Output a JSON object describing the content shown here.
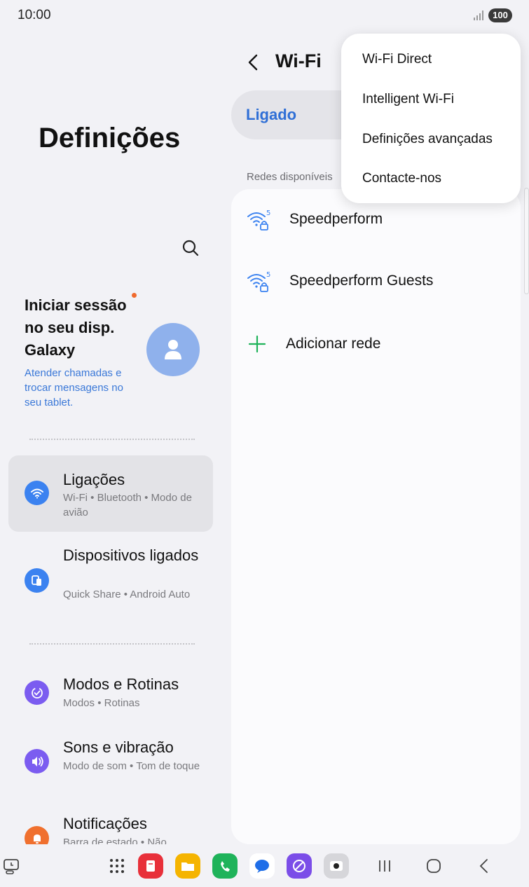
{
  "status_bar": {
    "time": "10:00",
    "battery": "100",
    "signal_icon": "signal-icon"
  },
  "settings": {
    "title": "Definições",
    "account": {
      "title": "Iniciar sessão no seu disp. Galaxy",
      "subtitle": "Atender chamadas e trocar mensagens no seu tablet."
    },
    "items": [
      {
        "title": "Ligações",
        "subtitle": "Wi-Fi  •  Bluetooth  •  Modo de avião",
        "icon": "wifi-icon",
        "color": "#3b82f0"
      },
      {
        "title": "Dispositivos ligados",
        "subtitle": "Quick Share  •  Android Auto",
        "icon": "devices-icon",
        "color": "#3b82f0"
      },
      {
        "title": "Modos e Rotinas",
        "subtitle": "Modos  •  Rotinas",
        "icon": "check-circle-icon",
        "color": "#7b5cf0"
      },
      {
        "title": "Sons e vibração",
        "subtitle": "Modo de som  •  Tom de toque",
        "icon": "sound-icon",
        "color": "#7b5cf0"
      },
      {
        "title": "Notificações",
        "subtitle": "Barra de estado  •  Não",
        "icon": "bell-icon",
        "color": "#f0702e"
      }
    ]
  },
  "wifi": {
    "title": "Wi-Fi",
    "toggle_label": "Ligado",
    "section_label": "Redes disponíveis",
    "networks": [
      {
        "name": "Speedperform",
        "icon": "wifi-5-locked-icon"
      },
      {
        "name": "Speedperform Guests",
        "icon": "wifi-5-locked-icon"
      }
    ],
    "add_network_label": "Adicionar rede"
  },
  "popup_menu": {
    "items": [
      "Wi-Fi Direct",
      "Intelligent Wi-Fi",
      "Definições avançadas",
      "Contacte-nos"
    ]
  },
  "navbar": {
    "apps": [
      {
        "name": "apps-grid-icon",
        "color": "#333333"
      },
      {
        "name": "notes-app-icon",
        "color": "#e8303a"
      },
      {
        "name": "files-app-icon",
        "color": "#f5b400"
      },
      {
        "name": "phone-app-icon",
        "color": "#1fb35a"
      },
      {
        "name": "messages-app-icon",
        "color": "#1f6ee8"
      },
      {
        "name": "internet-app-icon",
        "color": "#7b4de8"
      },
      {
        "name": "camera-app-icon",
        "color": "#d0d0d4"
      }
    ]
  },
  "colors": {
    "accent": "#2f6fd6",
    "background": "#f2f2f6",
    "card": "#fbfbfd"
  }
}
